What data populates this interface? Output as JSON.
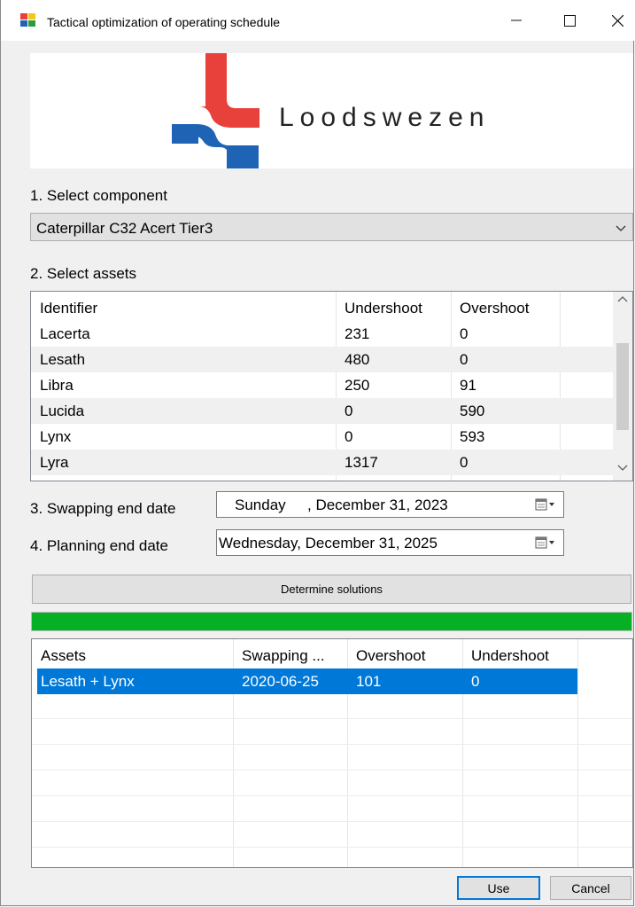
{
  "window": {
    "title": "Tactical optimization of operating schedule",
    "min_icon": "minimize-icon",
    "max_icon": "maximize-icon",
    "close_icon": "close-icon"
  },
  "logo": {
    "text": "Loodswezen",
    "red": "#e8403a",
    "blue": "#1e63b4"
  },
  "step1": {
    "label": "1. Select component",
    "selected": "Caterpillar C32 Acert Tier3"
  },
  "step2": {
    "label": "2. Select assets",
    "columns": [
      "Identifier",
      "Undershoot",
      "Overshoot"
    ],
    "rows": [
      [
        "Lacerta",
        "231",
        "0"
      ],
      [
        "Lesath",
        "480",
        "0"
      ],
      [
        "Libra",
        "250",
        "91"
      ],
      [
        "Lucida",
        "0",
        "590"
      ],
      [
        "Lynx",
        "0",
        "593"
      ],
      [
        "Lyra",
        "1317",
        "0"
      ]
    ]
  },
  "step3": {
    "label": "3. Swapping end date",
    "day": "Sunday",
    "date": ", December 31, 2023"
  },
  "step4": {
    "label": "4. Planning end date",
    "value": "Wednesday, December 31, 2025"
  },
  "determine": {
    "label": "Determine solutions"
  },
  "progress": {
    "value": 1.0,
    "color": "#06b025"
  },
  "solutions": {
    "columns": [
      "Assets",
      "Swapping ...",
      "Overshoot",
      "Undershoot"
    ],
    "rows": [
      [
        "Lesath + Lynx",
        "2020-06-25",
        "101",
        "0"
      ]
    ]
  },
  "buttons": {
    "use": "Use",
    "cancel": "Cancel"
  }
}
